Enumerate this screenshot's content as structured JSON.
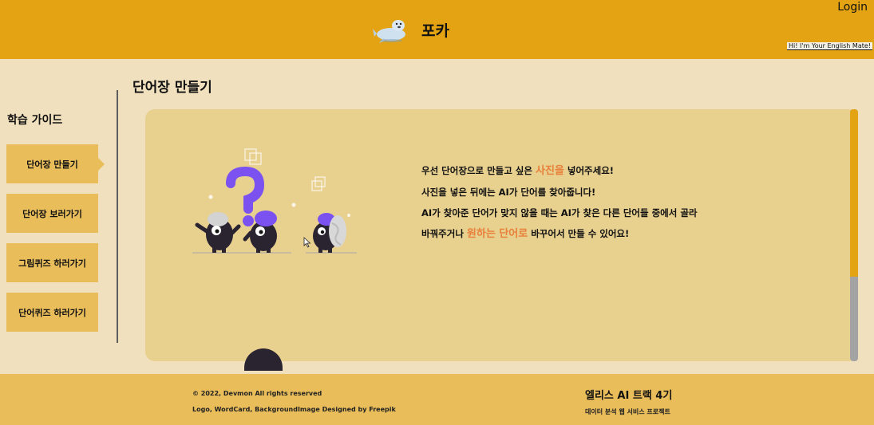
{
  "header": {
    "brand": "포카",
    "login": "Login",
    "tagline": "Hi! I'm Your English Mate!"
  },
  "sidebar": {
    "title": "학습 가이드",
    "items": [
      {
        "label": "단어장 만들기"
      },
      {
        "label": "단어장 보러가기"
      },
      {
        "label": "그림퀴즈 하러가기"
      },
      {
        "label": "단어퀴즈 하러가기"
      }
    ]
  },
  "main": {
    "title": "단어장 만들기",
    "guide": {
      "line1_pre": "우선 단어장으로 만들고 싶은 ",
      "line1_hl": "사진을",
      "line1_post": " 넣어주세요!",
      "line2": "사진을 넣은 뒤에는 AI가 단어를 찾아줍니다!",
      "line3": "AI가 찾아준 단어가 맞지 않을 때는 AI가 찾은 다른 단어들 중에서 골라",
      "line4_pre": "바꿔주거나 ",
      "line4_hl": "원하는 단어로",
      "line4_post": " 바꾸어서 만들 수 있어요!"
    }
  },
  "footer": {
    "copyright": "© 2022, Devmon All rights reserved",
    "credits": "Logo, WordCard, BackgroundImage Designed by Freepik",
    "track": "엘리스 AI 트랙 4기",
    "project": "데이터 분석 웹 서비스 프로젝트"
  },
  "colors": {
    "header": "#e3a313",
    "background": "#f1e0bd",
    "sidebar_item": "#e9bd5a",
    "card": "#e8d08f",
    "highlight": "#e8803b",
    "footer": "#e9bd5a",
    "character_purple": "#7b52f0"
  }
}
